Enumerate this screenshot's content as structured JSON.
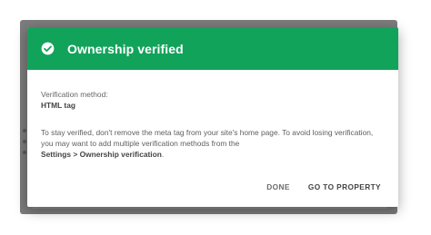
{
  "dialog": {
    "title": "Ownership verified",
    "method_label": "Verification method:",
    "method_value": "HTML tag",
    "advice_text": "To stay verified, don't remove the meta tag from your site's home page. To avoid losing verification, you may want to add multiple verification methods from the",
    "advice_path": "Settings > Ownership verification",
    "advice_suffix": ".",
    "done_label": "DONE",
    "goto_label": "GO TO PROPERTY"
  },
  "colors": {
    "header": "#12a35b",
    "backdrop": "#7c7c7c"
  },
  "icons": {
    "header_icon": "check-circle-icon"
  }
}
